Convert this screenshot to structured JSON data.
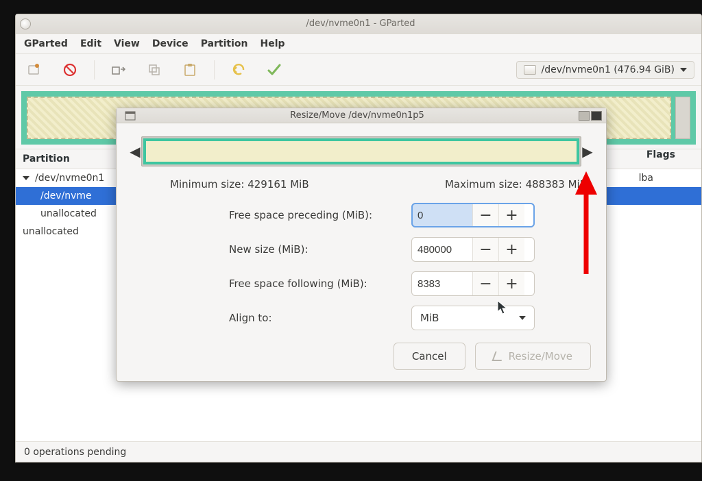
{
  "main_window": {
    "title": "/dev/nvme0n1 - GParted"
  },
  "menubar": {
    "gparted": "GParted",
    "edit": "Edit",
    "view": "View",
    "device": "Device",
    "partition": "Partition",
    "help": "Help"
  },
  "device_selector": {
    "text": "/dev/nvme0n1  (476.94 GiB)"
  },
  "partition_table": {
    "header_partition": "Partition",
    "header_flags": "Flags",
    "rows": [
      {
        "label": "/dev/nvme0n1",
        "selected": false,
        "expander": true
      },
      {
        "label": "/dev/nvme",
        "selected": true,
        "expander": false
      },
      {
        "label": "unallocated",
        "selected": false,
        "expander": false
      },
      {
        "label": "unallocated",
        "selected": false,
        "expander": false
      }
    ],
    "flags_value": "lba"
  },
  "statusbar": {
    "text": "0 operations pending"
  },
  "dialog": {
    "title": "Resize/Move /dev/nvme0n1p5",
    "min_size_label": "Minimum size: 429161 MiB",
    "max_size_label": "Maximum size: 488383 MiB",
    "free_preceding_label": "Free space preceding (MiB):",
    "free_preceding_value": "0",
    "new_size_label": "New size (MiB):",
    "new_size_value": "480000",
    "free_following_label": "Free space following (MiB):",
    "free_following_value": "8383",
    "align_to_label": "Align to:",
    "align_to_value": "MiB",
    "cancel": "Cancel",
    "resize_move": "Resize/Move"
  }
}
